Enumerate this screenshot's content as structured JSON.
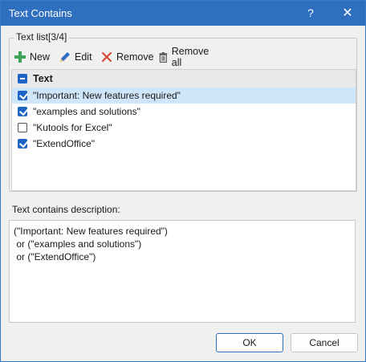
{
  "window": {
    "title": "Text Contains",
    "help_label": "?",
    "close_label": "✕"
  },
  "group": {
    "label": "Text list[3/4]"
  },
  "toolbar": {
    "new_label": "New",
    "edit_label": "Edit",
    "remove_label": "Remove",
    "remove_all_label": "Remove all"
  },
  "list": {
    "header": "Text",
    "items": [
      {
        "text": "\"Important: New features required\"",
        "checked": true
      },
      {
        "text": "\"examples and solutions\"",
        "checked": true
      },
      {
        "text": "\"Kutools for Excel\"",
        "checked": false
      },
      {
        "text": "\"ExtendOffice\"",
        "checked": true
      }
    ]
  },
  "description": {
    "label": "Text contains description:",
    "lines": [
      "(\"Important: New features required\")",
      " or (\"examples and solutions\")",
      " or (\"ExtendOffice\")"
    ]
  },
  "buttons": {
    "ok_label": "OK",
    "cancel_label": "Cancel"
  },
  "colors": {
    "titlebar": "#2f6fbf",
    "checkbox_checked": "#1e63c6",
    "selected_row": "#cfe5fa",
    "new_icon": "#3aa655",
    "remove_icon": "#d9432f"
  }
}
